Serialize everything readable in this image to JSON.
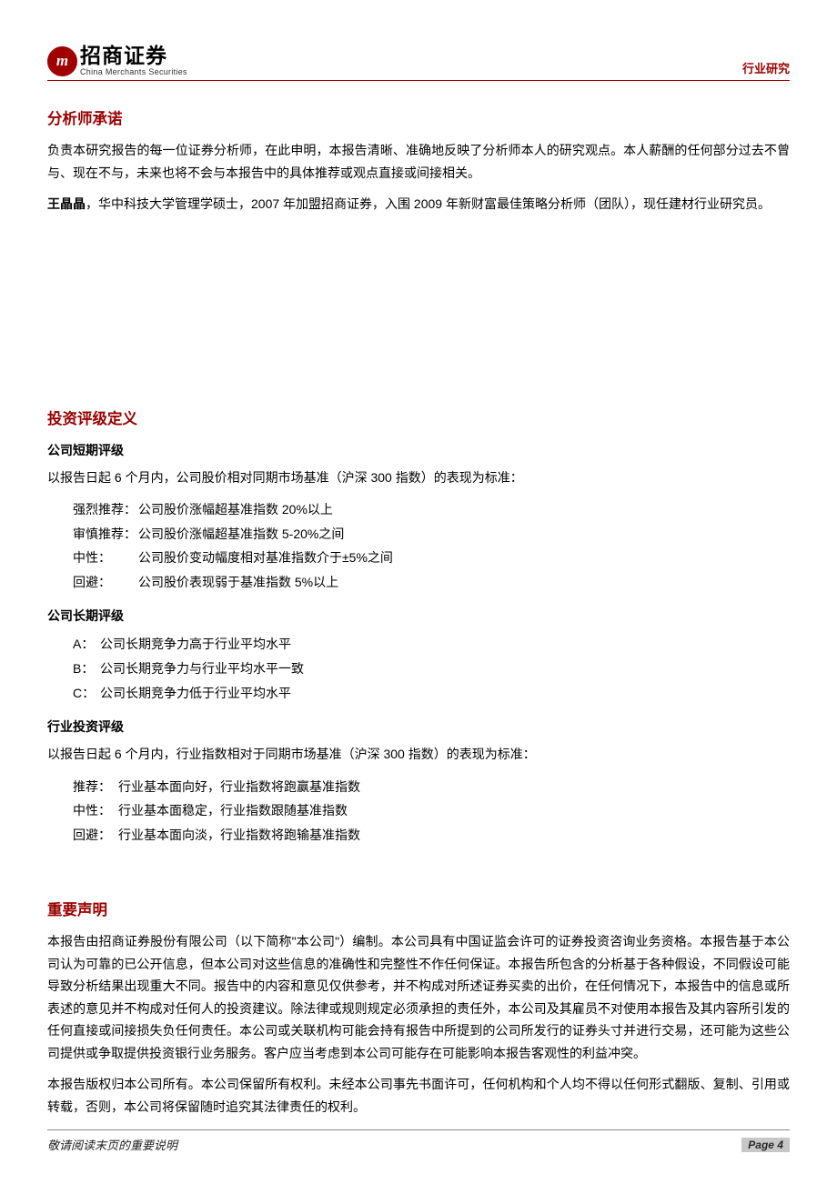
{
  "header": {
    "logo_mark": "m",
    "logo_cn": "招商证券",
    "logo_en": "China Merchants Securities",
    "right_label": "行业研究"
  },
  "analyst_commitment": {
    "title": "分析师承诺",
    "p1": "负责本研究报告的每一位证券分析师，在此申明，本报告清晰、准确地反映了分析师本人的研究观点。本人薪酬的任何部分过去不曾与、现在不与，未来也将不会与本报告中的具体推荐或观点直接或间接相关。",
    "name": "王晶晶",
    "p2_rest": "，华中科技大学管理学硕士，2007 年加盟招商证券，入围 2009 年新财富最佳策略分析师（团队），现任建材行业研究员。"
  },
  "rating_def": {
    "title": "投资评级定义",
    "company_short": {
      "heading": "公司短期评级",
      "intro": "以报告日起 6 个月内，公司股价相对同期市场基准（沪深 300 指数）的表现为标准：",
      "rows": [
        {
          "label": "强烈推荐：",
          "desc": "公司股价涨幅超基准指数 20%以上"
        },
        {
          "label": "审慎推荐：",
          "desc": "公司股价涨幅超基准指数 5-20%之间"
        },
        {
          "label": "中性：",
          "desc": "公司股价变动幅度相对基准指数介于±5%之间"
        },
        {
          "label": "回避：",
          "desc": "公司股价表现弱于基准指数 5%以上"
        }
      ]
    },
    "company_long": {
      "heading": "公司长期评级",
      "rows": [
        {
          "label": "A：",
          "desc": "公司长期竞争力高于行业平均水平"
        },
        {
          "label": "B：",
          "desc": "公司长期竞争力与行业平均水平一致"
        },
        {
          "label": "C：",
          "desc": "公司长期竞争力低于行业平均水平"
        }
      ]
    },
    "industry": {
      "heading": "行业投资评级",
      "intro": "以报告日起 6 个月内，行业指数相对于同期市场基准（沪深 300 指数）的表现为标准：",
      "rows": [
        {
          "label": "推荐：",
          "desc": "行业基本面向好，行业指数将跑赢基准指数"
        },
        {
          "label": "中性：",
          "desc": "行业基本面稳定，行业指数跟随基准指数"
        },
        {
          "label": "回避：",
          "desc": "行业基本面向淡，行业指数将跑输基准指数"
        }
      ]
    }
  },
  "disclaimer": {
    "title": "重要声明",
    "p1": "本报告由招商证券股份有限公司（以下简称\"本公司\"）编制。本公司具有中国证监会许可的证券投资咨询业务资格。本报告基于本公司认为可靠的已公开信息，但本公司对这些信息的准确性和完整性不作任何保证。本报告所包含的分析基于各种假设，不同假设可能导致分析结果出现重大不同。报告中的内容和意见仅供参考，并不构成对所述证券买卖的出价，在任何情况下，本报告中的信息或所表述的意见并不构成对任何人的投资建议。除法律或规则规定必须承担的责任外，本公司及其雇员不对使用本报告及其内容所引发的任何直接或间接损失负任何责任。本公司或关联机构可能会持有报告中所提到的公司所发行的证券头寸并进行交易，还可能为这些公司提供或争取提供投资银行业务服务。客户应当考虑到本公司可能存在可能影响本报告客观性的利益冲突。",
    "p2": "本报告版权归本公司所有。本公司保留所有权利。未经本公司事先书面许可，任何机构和个人均不得以任何形式翻版、复制、引用或转载，否则，本公司将保留随时追究其法律责任的权利。"
  },
  "footer": {
    "left": "敬请阅读末页的重要说明",
    "page": "Page 4"
  }
}
